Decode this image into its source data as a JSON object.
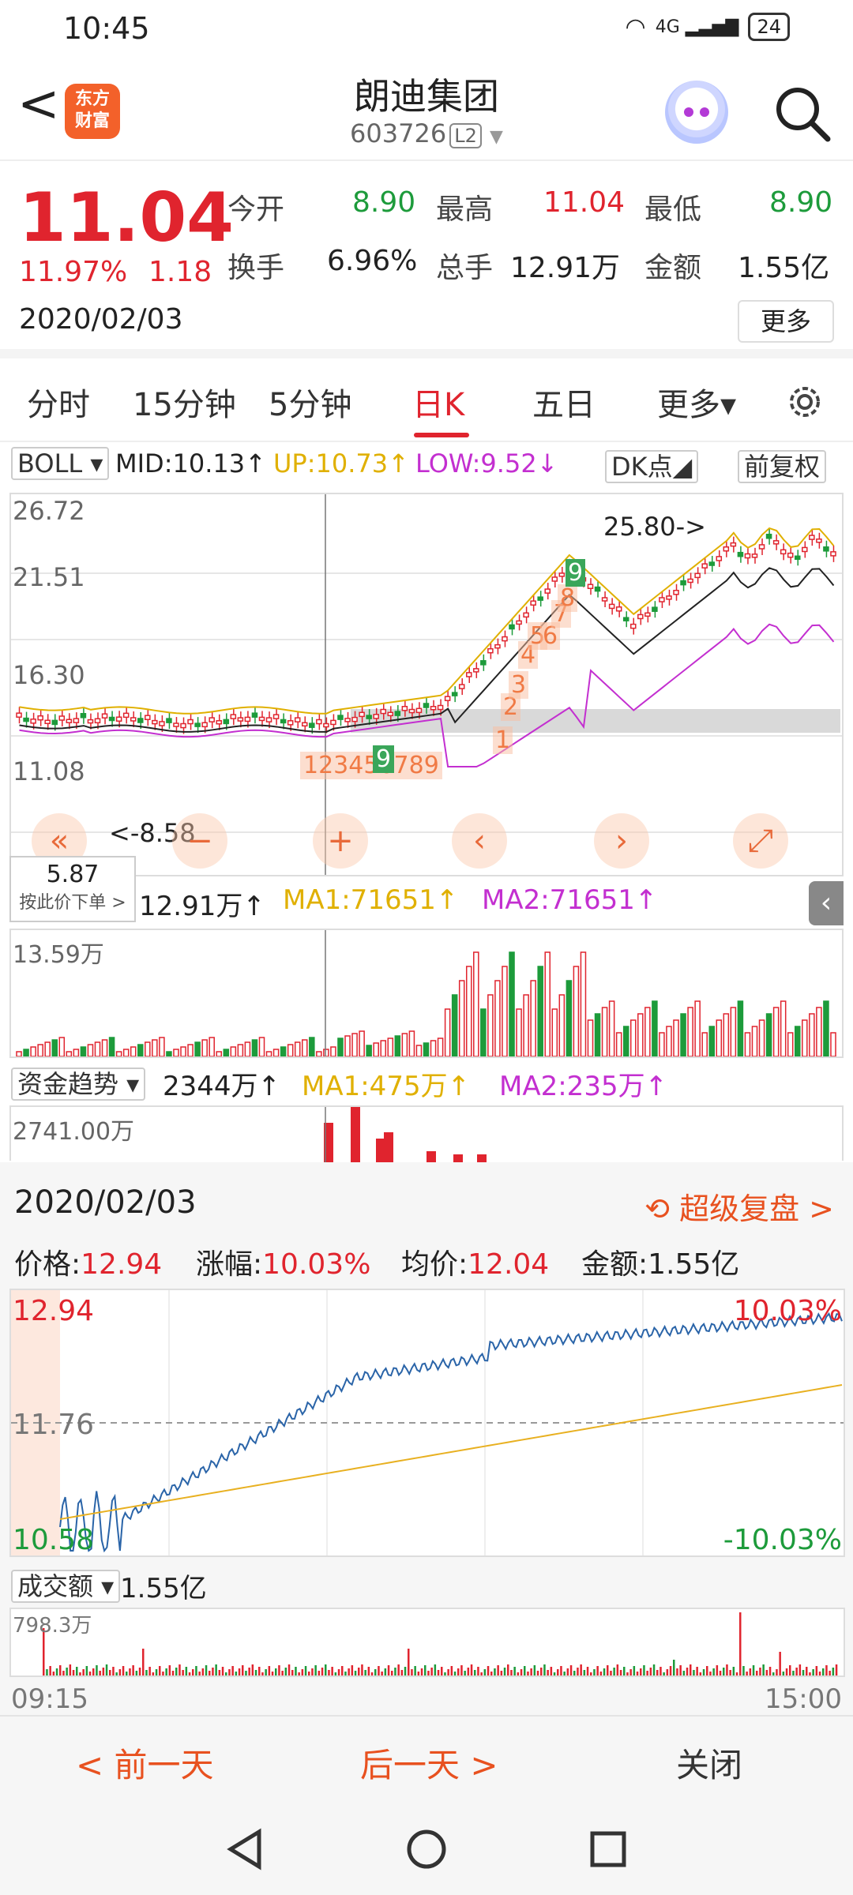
{
  "status": {
    "time": "10:45",
    "signal": "4G",
    "battery": "24"
  },
  "header": {
    "back_glyph": "<",
    "logo_line1": "东方",
    "logo_line2": "财富",
    "title": "朗迪集团",
    "code": "603726",
    "code_badge": "L2"
  },
  "quote": {
    "price": "11.04",
    "pct": "11.97%",
    "change": "1.18",
    "date": "2020/02/03",
    "open_label": "今开",
    "open": "8.90",
    "high_label": "最高",
    "high": "11.04",
    "low_label": "最低",
    "low": "8.90",
    "turnover_label": "换手",
    "turnover": "6.96%",
    "volume_label": "总手",
    "volume": "12.91万",
    "amount_label": "金额",
    "amount": "1.55亿",
    "more": "更多"
  },
  "tabs": [
    "分时",
    "15分钟",
    "5分钟",
    "日K",
    "五日",
    "更多▾"
  ],
  "boll": {
    "name": "BOLL ▾",
    "mid": "MID:10.13↑",
    "up": "UP:10.73↑",
    "low": "LOW:9.52↓",
    "dk": "DK点◢",
    "adj": "前复权",
    "y_labels": [
      "26.72",
      "21.51",
      "16.30",
      "11.08"
    ],
    "marker_high": "25.80->",
    "marker_low": "<-8.58",
    "seq_small": "123456789",
    "seq_small_last": "9",
    "seq_big": [
      "1",
      "2",
      "3",
      "4",
      "5",
      "6",
      "7",
      "8",
      "9"
    ]
  },
  "price_bubble": {
    "value": "5.87",
    "sub": "按此价下单 >"
  },
  "volume": {
    "value": "12.91万↑",
    "ma1": "MA1:71651↑",
    "ma2": "MA2:71651↑",
    "y_label": "13.59万"
  },
  "fund": {
    "name": "资金趋势 ▾",
    "value": "2344万↑",
    "ma1": "MA1:475万↑",
    "ma2": "MA2:235万↑",
    "y_label": "2741.00万"
  },
  "intraday": {
    "date": "2020/02/03",
    "link": "超级复盘 >",
    "price_label": "价格:",
    "price": "12.94",
    "change_label": "涨幅:",
    "change": "10.03%",
    "avg_label": "均价:",
    "avg": "12.04",
    "amount_label": "金额:",
    "amount": "1.55亿",
    "y_top": "12.94",
    "y_mid": "11.76",
    "y_bot": "10.58",
    "pct_top": "10.03%",
    "pct_bot": "-10.03%",
    "vol_name": "成交额 ▾",
    "vol_value": "1.55亿",
    "vol_y": "798.3万",
    "t_start": "09:15",
    "t_end": "15:00"
  },
  "nav": {
    "prev": "< 前一天",
    "next": "后一天 >",
    "close": "关闭"
  },
  "colors": {
    "up": "#e0242e",
    "down": "#1d9b3b",
    "accent": "#e8511f",
    "ma_yellow": "#e0b000",
    "ma_magenta": "#c32fd0"
  }
}
